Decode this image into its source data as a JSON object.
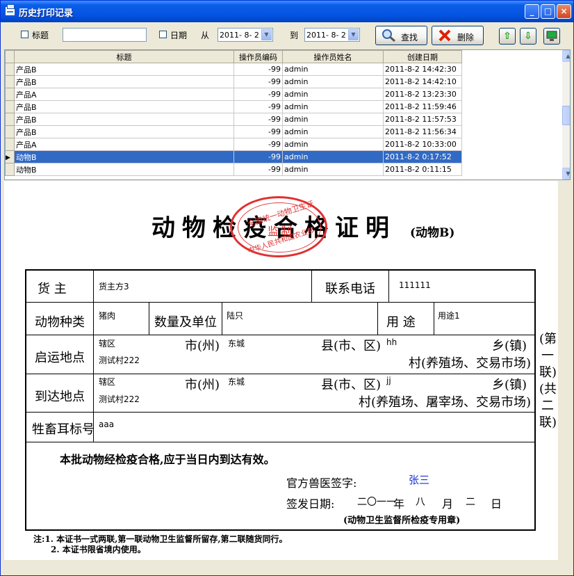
{
  "window": {
    "title": "历史打印记录",
    "minimize": "_",
    "maximize": "□",
    "close": "×"
  },
  "filters": {
    "title_label": "标题",
    "title_value": "",
    "date_label": "日期",
    "from_label": "从",
    "from_value": "2011- 8- 2",
    "to_label": "到",
    "to_value": "2011- 8- 2"
  },
  "buttons": {
    "search": "查找",
    "delete": "删除",
    "up": "⇧",
    "down": "⇩"
  },
  "icons": {
    "window": "printer-icon",
    "search": "magnifier-icon",
    "delete": "red-x-icon",
    "up": "up-arrow-icon",
    "down": "down-arrow-icon",
    "screen": "monitor-icon"
  },
  "colors": {
    "title_bar": "#0a5ee8",
    "selection": "#316ac5",
    "seal": "#e03030"
  },
  "grid": {
    "columns": [
      "标题",
      "操作员编码",
      "操作员姓名",
      "创建日期"
    ],
    "rows": [
      {
        "title": "产品B",
        "code": "-99",
        "name": "admin",
        "date": "2011-8-2 14:42:30"
      },
      {
        "title": "产品B",
        "code": "-99",
        "name": "admin",
        "date": "2011-8-2 14:42:10"
      },
      {
        "title": "产品A",
        "code": "-99",
        "name": "admin",
        "date": "2011-8-2 13:23:30"
      },
      {
        "title": "产品B",
        "code": "-99",
        "name": "admin",
        "date": "2011-8-2 11:59:46"
      },
      {
        "title": "产品B",
        "code": "-99",
        "name": "admin",
        "date": "2011-8-2 11:57:53"
      },
      {
        "title": "产品B",
        "code": "-99",
        "name": "admin",
        "date": "2011-8-2 11:56:34"
      },
      {
        "title": "产品A",
        "code": "-99",
        "name": "admin",
        "date": "2011-8-2 10:33:00"
      },
      {
        "title": "动物B",
        "code": "-99",
        "name": "admin",
        "date": "2011-8-2 0:17:52",
        "selected": true
      },
      {
        "title": "动物B",
        "code": "-99",
        "name": "admin",
        "date": "2011-8-2 0:11:15"
      }
    ]
  },
  "cert": {
    "title": "动物检疫合格证明",
    "subtitle": "(动物B)",
    "seal": {
      "top": "全国统一动物卫生证",
      "middle": "监制",
      "bottom": "中华人民共和国农业部"
    },
    "owner_label": "货 主",
    "owner_value": "货主方3",
    "phone_label": "联系电话",
    "phone_value": "111111",
    "species_label": "动物种类",
    "species_value": "猪肉",
    "qty_label": "数量及单位",
    "qty_value": "陆只",
    "use_label": "用 途",
    "use_value": "用途1",
    "origin_label": "启运地点",
    "dest_label": "到达地点",
    "city_label": "市(州)",
    "county_label": "县(市、区)",
    "town_label": "乡(镇)",
    "origin_village_label": "村(养殖场、交易市场)",
    "dest_village_label": "村(养殖场、屠宰场、交易市场)",
    "origin": {
      "area": "辖区",
      "city": "东城",
      "county": "hh",
      "village": "测试村222"
    },
    "dest": {
      "area": "辖区",
      "city": "东城",
      "county": "jj",
      "village": "测试村222"
    },
    "tag_label": "牲畜耳标号",
    "tag_value": "aaa",
    "valid_text": "本批动物经检疫合格,应于当日内到达有效。",
    "vet_label": "官方兽医签字:",
    "vet_value": "张三",
    "issue_label": "签发日期:",
    "year": "二〇一一",
    "year_unit": "年",
    "month": "八",
    "month_unit": "月",
    "day": "二",
    "day_unit": "日",
    "stamp_note": "(动物卫生监督所检疫专用章)",
    "side": "(第一联)(共二联)",
    "note1": "注:1. 本证书一式两联,第一联动物卫生监督所留存,第二联随货同行。",
    "note2": "2. 本证书限省境内使用。"
  }
}
